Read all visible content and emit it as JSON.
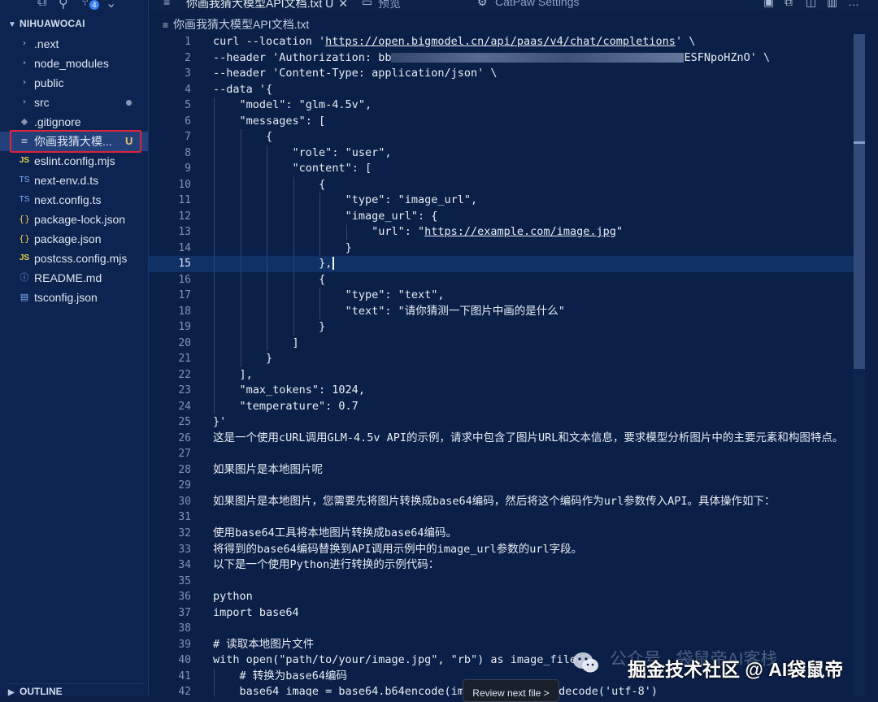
{
  "activity_bar": {
    "badge_count": "4"
  },
  "tabs": {
    "active_label": "你画我猜大模型API文档.txt",
    "active_status": "U",
    "preview_label": "预览",
    "settings_label": "CatPaw Settings"
  },
  "explorer": {
    "title": "NIHUAWOCAI",
    "items": [
      {
        "label": ".next",
        "kind": "folder",
        "icon": "chevron-right-icon"
      },
      {
        "label": "node_modules",
        "kind": "folder",
        "icon": "chevron-right-icon"
      },
      {
        "label": "public",
        "kind": "folder",
        "icon": "chevron-right-icon"
      },
      {
        "label": "src",
        "kind": "folder",
        "icon": "chevron-right-icon",
        "modified_dot": true
      },
      {
        "label": ".gitignore",
        "kind": "file",
        "icon": "git-icon"
      },
      {
        "label": "你画我猜大模...",
        "kind": "file",
        "icon": "text-file-icon",
        "status": "U",
        "selected": true
      },
      {
        "label": "eslint.config.mjs",
        "kind": "file",
        "icon": "js-icon"
      },
      {
        "label": "next-env.d.ts",
        "kind": "file",
        "icon": "ts-icon"
      },
      {
        "label": "next.config.ts",
        "kind": "file",
        "icon": "ts-icon"
      },
      {
        "label": "package-lock.json",
        "kind": "file",
        "icon": "json-icon"
      },
      {
        "label": "package.json",
        "kind": "file",
        "icon": "json-icon"
      },
      {
        "label": "postcss.config.mjs",
        "kind": "file",
        "icon": "js-icon"
      },
      {
        "label": "README.md",
        "kind": "file",
        "icon": "info-icon"
      },
      {
        "label": "tsconfig.json",
        "kind": "file",
        "icon": "tsconfig-icon"
      }
    ],
    "outline_title": "OUTLINE"
  },
  "breadcrumb": {
    "file": "你画我猜大模型API文档.txt"
  },
  "code_lines": [
    {
      "n": "1",
      "indent": 0,
      "pre": "curl --location '",
      "link": "https://open.bigmodel.cn/api/paas/v4/chat/completions",
      "post": "' \\"
    },
    {
      "n": "2",
      "indent": 0,
      "pre": "--header 'Authorization: bb",
      "masked": true,
      "post": "ESFNpoHZnO' \\"
    },
    {
      "n": "3",
      "indent": 0,
      "pre": "--header 'Content-Type: application/json' \\"
    },
    {
      "n": "4",
      "indent": 0,
      "pre": "--data '{"
    },
    {
      "n": "5",
      "indent": 1,
      "pre": "\"model\": \"glm-4.5v\","
    },
    {
      "n": "6",
      "indent": 1,
      "pre": "\"messages\": ["
    },
    {
      "n": "7",
      "indent": 2,
      "pre": "{"
    },
    {
      "n": "8",
      "indent": 3,
      "pre": "\"role\": \"user\","
    },
    {
      "n": "9",
      "indent": 3,
      "pre": "\"content\": ["
    },
    {
      "n": "10",
      "indent": 4,
      "pre": "{"
    },
    {
      "n": "11",
      "indent": 5,
      "pre": "\"type\": \"image_url\","
    },
    {
      "n": "12",
      "indent": 5,
      "pre": "\"image_url\": {"
    },
    {
      "n": "13",
      "indent": 6,
      "pre": "\"url\": \"",
      "link": "https://example.com/image.jpg",
      "post": "\""
    },
    {
      "n": "14",
      "indent": 5,
      "pre": "}"
    },
    {
      "n": "15",
      "indent": 4,
      "pre": "},",
      "current": true
    },
    {
      "n": "16",
      "indent": 4,
      "pre": "{"
    },
    {
      "n": "17",
      "indent": 5,
      "pre": "\"type\": \"text\","
    },
    {
      "n": "18",
      "indent": 5,
      "pre": "\"text\": \"请你猜测一下图片中画的是什么\""
    },
    {
      "n": "19",
      "indent": 4,
      "pre": "}"
    },
    {
      "n": "20",
      "indent": 3,
      "pre": "]"
    },
    {
      "n": "21",
      "indent": 2,
      "pre": "}"
    },
    {
      "n": "22",
      "indent": 1,
      "pre": "],"
    },
    {
      "n": "23",
      "indent": 1,
      "pre": "\"max_tokens\": 1024,"
    },
    {
      "n": "24",
      "indent": 1,
      "pre": "\"temperature\": 0.7"
    },
    {
      "n": "25",
      "indent": 0,
      "pre": "}'"
    },
    {
      "n": "26",
      "indent": 0,
      "pre": "这是一个使用cURL调用GLM-4.5v API的示例，请求中包含了图片URL和文本信息，要求模型分析图片中的主要元素和构图特点。"
    },
    {
      "n": "27",
      "indent": 0,
      "pre": ""
    },
    {
      "n": "28",
      "indent": 0,
      "pre": "如果图片是本地图片呢"
    },
    {
      "n": "29",
      "indent": 0,
      "pre": ""
    },
    {
      "n": "30",
      "indent": 0,
      "pre": "如果图片是本地图片，您需要先将图片转换成base64编码，然后将这个编码作为url参数传入API。具体操作如下："
    },
    {
      "n": "31",
      "indent": 0,
      "pre": ""
    },
    {
      "n": "32",
      "indent": 0,
      "pre": "使用base64工具将本地图片转换成base64编码。"
    },
    {
      "n": "33",
      "indent": 0,
      "pre": "将得到的base64编码替换到API调用示例中的image_url参数的url字段。"
    },
    {
      "n": "34",
      "indent": 0,
      "pre": "以下是一个使用Python进行转换的示例代码："
    },
    {
      "n": "35",
      "indent": 0,
      "pre": ""
    },
    {
      "n": "36",
      "indent": 0,
      "pre": "python"
    },
    {
      "n": "37",
      "indent": 0,
      "pre": "import base64"
    },
    {
      "n": "38",
      "indent": 0,
      "pre": ""
    },
    {
      "n": "39",
      "indent": 0,
      "pre": "# 读取本地图片文件"
    },
    {
      "n": "40",
      "indent": 0,
      "pre": "with open(\"path/to/your/image.jpg\", \"rb\") as image_file:"
    },
    {
      "n": "41",
      "indent": 1,
      "pre": "# 转换为base64编码"
    },
    {
      "n": "42",
      "indent": 1,
      "pre": "base64_image = base64.b64encode(ima",
      "post": ".decode('utf-8')"
    }
  ],
  "tooltip": {
    "review": "Review next file >"
  },
  "watermark": {
    "back_text": "公众号 · 袋鼠帝AI客栈",
    "front_text": "掘金技术社区 @ AI袋鼠帝"
  },
  "colors": {
    "background": "#0b2049",
    "selection_border": "#e0243a",
    "current_line": "#0f3166"
  }
}
